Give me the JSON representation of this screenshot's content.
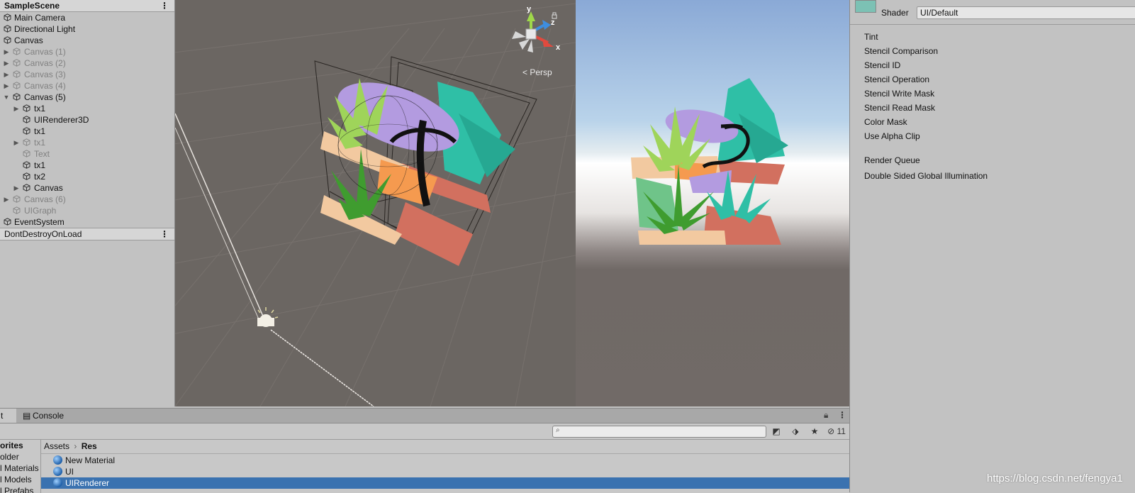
{
  "hierarchy": {
    "scene_name": "SampleScene",
    "menu_glyph": "⋮",
    "items": [
      {
        "label": "Main Camera"
      },
      {
        "label": "Directional Light"
      },
      {
        "label": "Canvas"
      },
      {
        "label": "Canvas (1)"
      },
      {
        "label": "Canvas (2)"
      },
      {
        "label": "Canvas (3)"
      },
      {
        "label": "Canvas (4)"
      },
      {
        "label": "Canvas (5)"
      },
      {
        "label": "tx1"
      },
      {
        "label": "UIRenderer3D"
      },
      {
        "label": "tx1"
      },
      {
        "label": "tx1"
      },
      {
        "label": "Text"
      },
      {
        "label": "tx1"
      },
      {
        "label": "tx2"
      },
      {
        "label": "Canvas"
      },
      {
        "label": "Canvas (6)"
      },
      {
        "label": "UIGraph"
      },
      {
        "label": "EventSystem"
      }
    ],
    "dont_destroy": "DontDestroyOnLoad"
  },
  "scene_view": {
    "gizmo_y": "y",
    "gizmo_z": "z",
    "gizmo_x": "x",
    "persp_label": "Persp"
  },
  "inspector": {
    "shader_label": "Shader",
    "shader_value": "UI/Default",
    "properties": [
      "Tint",
      "Stencil Comparison",
      "Stencil ID",
      "Stencil Operation",
      "Stencil Write Mask",
      "Stencil Read Mask",
      "Color Mask",
      "Use Alpha Clip"
    ],
    "render_queue": "Render Queue",
    "double_sided": "Double Sided Global Illumination"
  },
  "project": {
    "tab_cut": "t",
    "console_tab": "Console",
    "hidden_count": "11",
    "favorites": [
      "orites",
      "older",
      "l Materials",
      "l Models",
      "l Prefabs"
    ],
    "breadcrumb_root": "Assets",
    "breadcrumb_sep": "›",
    "breadcrumb_current": "Res",
    "assets": [
      {
        "label": "New Material",
        "selected": false
      },
      {
        "label": "UI",
        "selected": false
      },
      {
        "label": "UIRenderer",
        "selected": true
      }
    ]
  },
  "watermark": "https://blog.csdn.net/fengya1",
  "colors": {
    "selection": "#3a72b0",
    "scene_bg": "#6b6662",
    "panel": "#c2c2c2"
  }
}
